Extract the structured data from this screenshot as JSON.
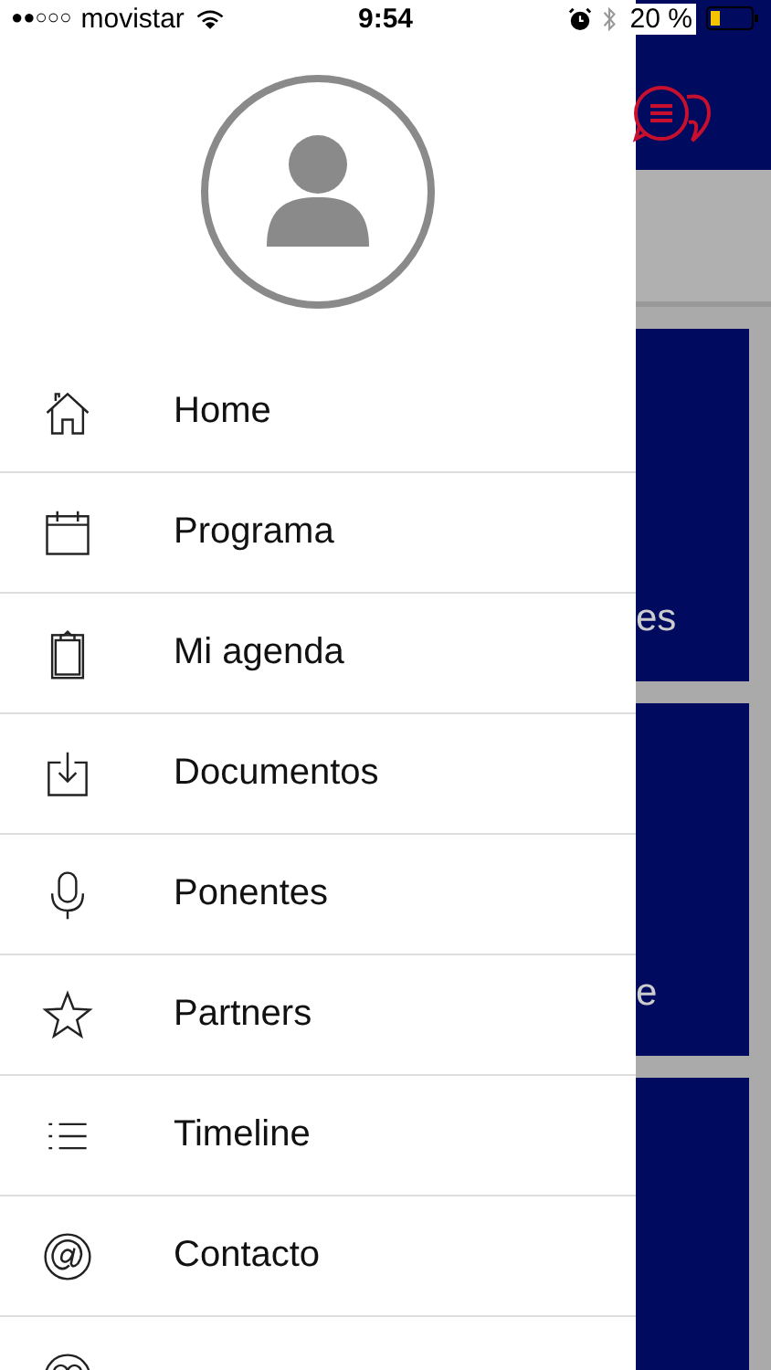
{
  "status_bar": {
    "signal": "●●○○○",
    "carrier": "movistar",
    "time": "9:54",
    "battery": "20 %"
  },
  "drawer": {
    "items": [
      {
        "label": "Home"
      },
      {
        "label": "Programa"
      },
      {
        "label": "Mi agenda"
      },
      {
        "label": "Documentos"
      },
      {
        "label": "Ponentes"
      },
      {
        "label": "Partners"
      },
      {
        "label": "Timeline"
      },
      {
        "label": "Contacto"
      }
    ]
  },
  "background_screen": {
    "cards": [
      {
        "text": "es"
      },
      {
        "text": "e"
      }
    ]
  }
}
